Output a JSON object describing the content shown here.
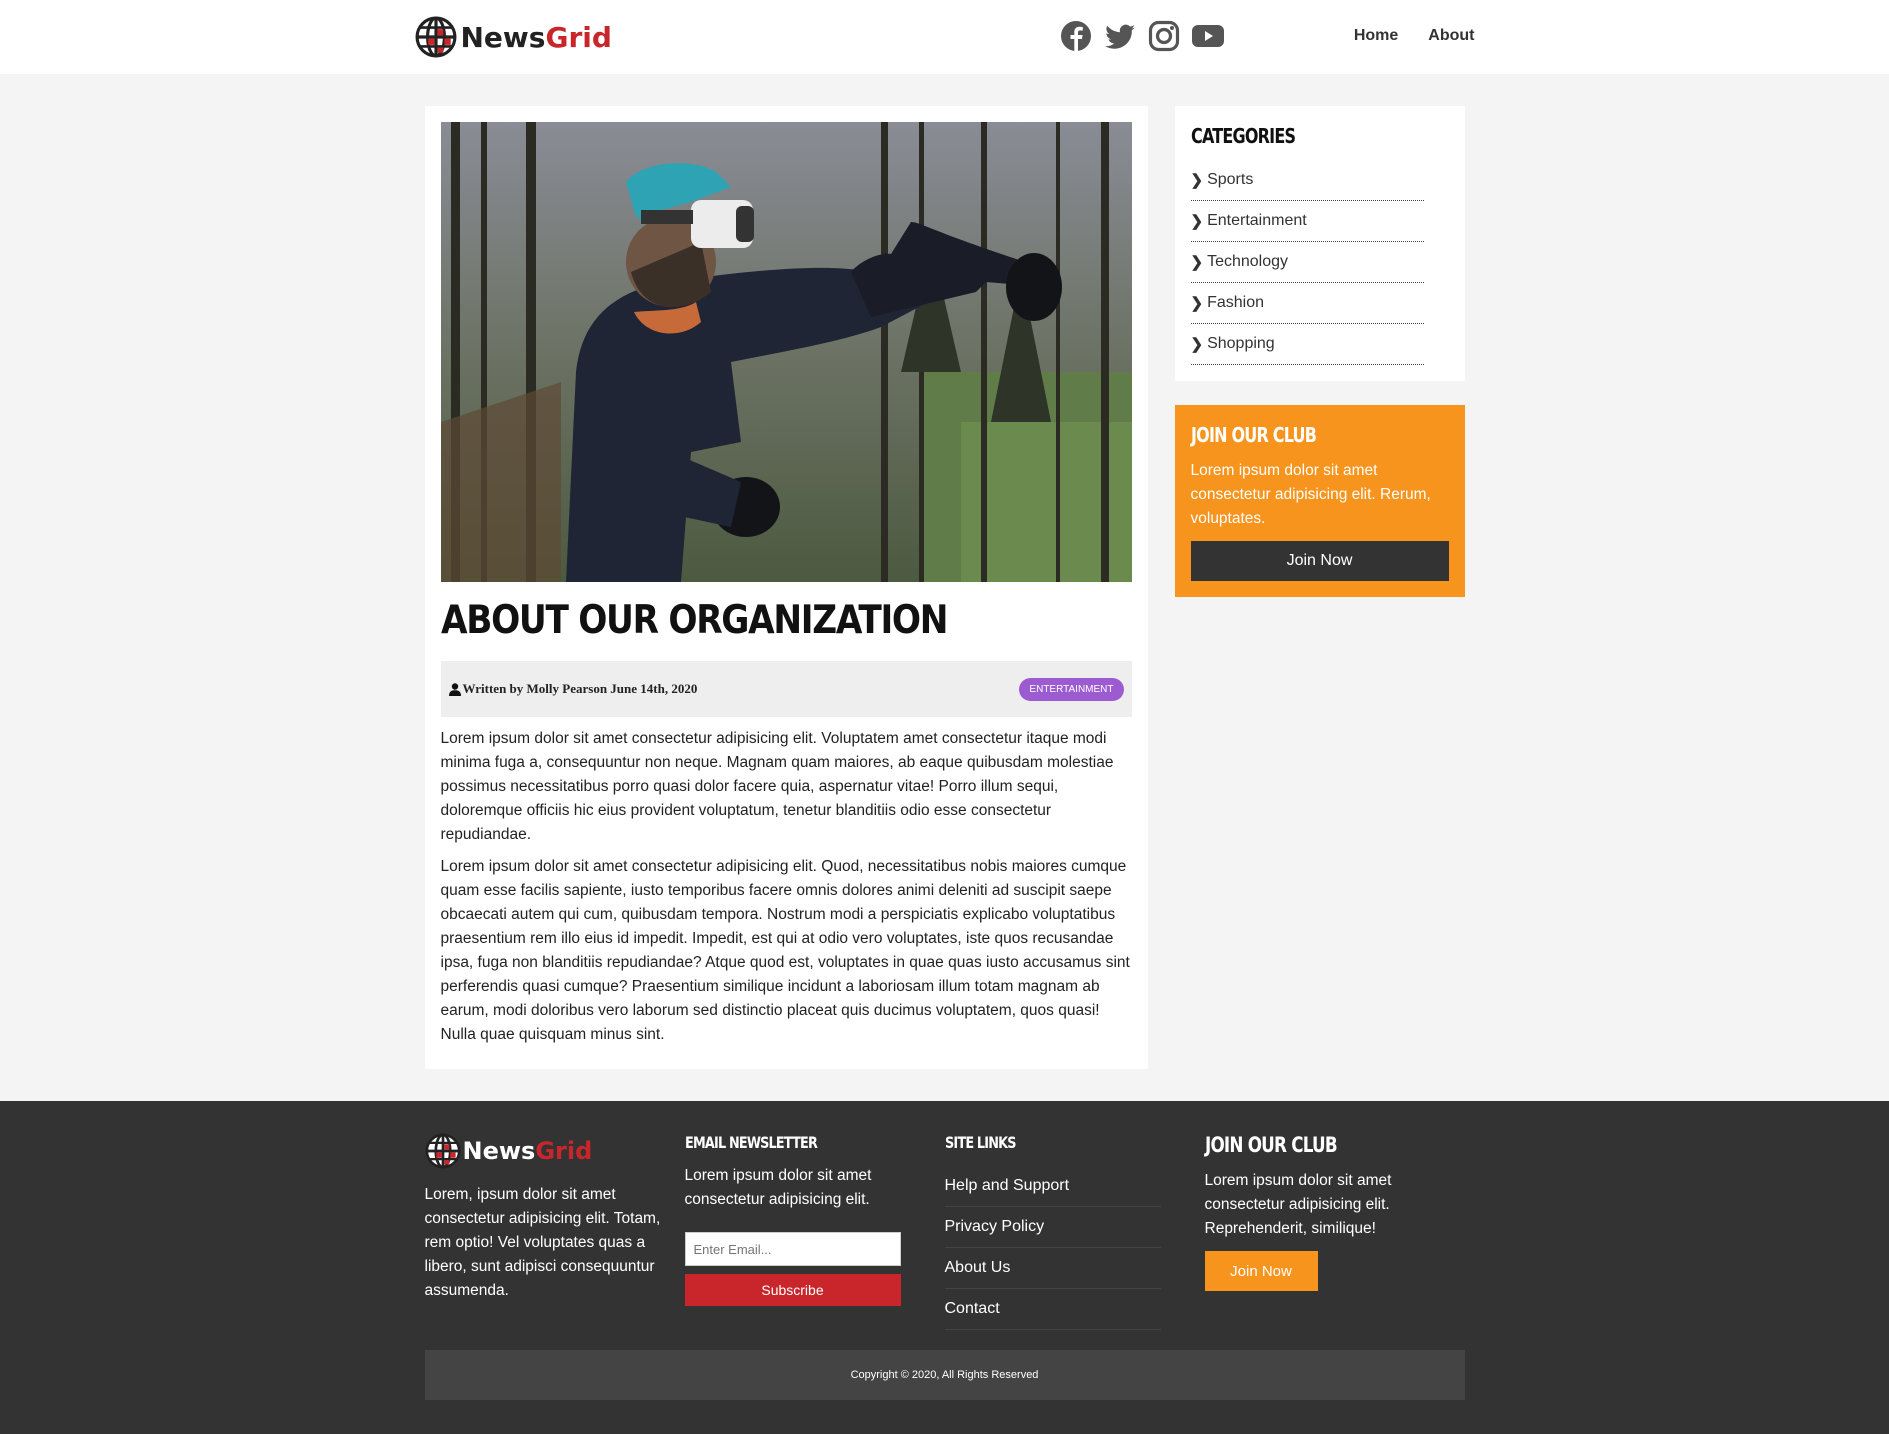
{
  "brand": {
    "name_part1": "News",
    "name_part2": "Grid",
    "accent_color": "#c8262b"
  },
  "header": {
    "social_icons": [
      "facebook-icon",
      "twitter-icon",
      "instagram-icon",
      "youtube-icon"
    ],
    "nav": {
      "home": "Home",
      "about": "About"
    }
  },
  "article": {
    "title": "About Our Organization",
    "byline": "Written by Molly Pearson June 14th, 2020",
    "category_badge": "Entertainment",
    "paragraphs": [
      "Lorem ipsum dolor sit amet consectetur adipisicing elit. Voluptatem amet consectetur itaque modi minima fuga a, consequuntur non neque. Magnam quam maiores, ab eaque quibusdam molestiae possimus necessitatibus porro quasi dolor facere quia, aspernatur vitae! Porro illum sequi, doloremque officiis hic eius provident voluptatum, tenetur blanditiis odio esse consectetur repudiandae.",
      "Lorem ipsum dolor sit amet consectetur adipisicing elit. Quod, necessitatibus nobis maiores cumque quam esse facilis sapiente, iusto temporibus facere omnis dolores animi deleniti ad suscipit saepe obcaecati autem qui cum, quibusdam tempora. Nostrum modi a perspiciatis explicabo voluptatibus praesentium rem illo eius id impedit. Impedit, est qui at odio vero voluptates, iste quos recusandae ipsa, fuga non blanditiis repudiandae? Atque quod est, voluptates in quae quas iusto accusamus sint perferendis quasi cumque? Praesentium similique incidunt a laboriosam illum totam magnam ab earum, modi doloribus vero laborum sed distinctio placeat quis ducimus voluptatem, quos quasi! Nulla quae quisquam minus sint."
    ]
  },
  "sidebar": {
    "categories_title": "Categories",
    "categories": [
      "Sports",
      "Entertainment",
      "Technology",
      "Fashion",
      "Shopping"
    ],
    "join": {
      "title": "Join Our Club",
      "text": "Lorem ipsum dolor sit amet consectetur adipisicing elit. Rerum, voluptates.",
      "button": "Join Now"
    }
  },
  "footer": {
    "about_text": "Lorem, ipsum dolor sit amet consectetur adipisicing elit. Totam, rem optio! Vel voluptates quas a libero, sunt adipisci consequuntur assumenda.",
    "newsletter": {
      "title": "Email Newsletter",
      "text": "Lorem ipsum dolor sit amet consectetur adipisicing elit.",
      "placeholder": "Enter Email...",
      "button": "Subscribe"
    },
    "site_links": {
      "title": "Site Links",
      "links": [
        "Help and Support",
        "Privacy Policy",
        "About Us",
        "Contact"
      ]
    },
    "join": {
      "title": "Join Our Club",
      "text": "Lorem ipsum dolor sit amet consectetur adipisicing elit. Reprehenderit, similique!",
      "button": "Join Now"
    },
    "copyright": "Copyright © 2020, All Rights Reserved"
  }
}
